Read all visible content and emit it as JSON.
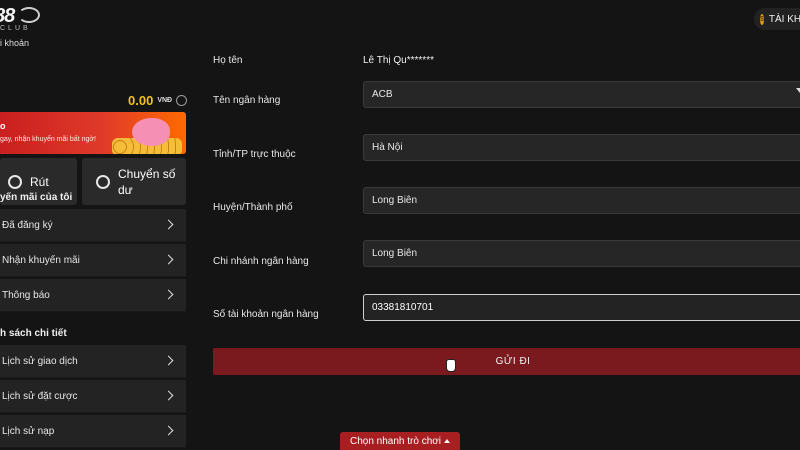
{
  "header": {
    "logo_text": "88",
    "logo_sub": "CLUB",
    "account_label": "TÀI KHOẢN",
    "coin_symbol": "$"
  },
  "sidebar": {
    "top_label": "i khoản",
    "balance": {
      "amount": "0.00",
      "currency": "VNĐ"
    },
    "promo": {
      "title": "o",
      "text": "gay, nhận khuyến mãi bất ngờ!"
    },
    "tiles": [
      {
        "label": "Rút"
      },
      {
        "label": "Chuyển số dư"
      }
    ],
    "promo_section_title": "yến mãi của tôi",
    "promo_items": [
      {
        "label": "Đã đăng ký"
      },
      {
        "label": "Nhận khuyến mãi"
      },
      {
        "label": "Thông báo"
      }
    ],
    "detail_section_title": "h sách chi tiết",
    "detail_items": [
      {
        "label": "Lịch sử giao dịch"
      },
      {
        "label": "Lịch sử đặt cược"
      },
      {
        "label": "Lịch sử nạp"
      }
    ]
  },
  "form": {
    "full_name": {
      "label": "Họ tên",
      "value": "Lê Thị Qu*******"
    },
    "bank_name": {
      "label": "Tên ngân hàng",
      "value": "ACB"
    },
    "province": {
      "label": "Tỉnh/TP trực thuộc",
      "value": "Hà Nội"
    },
    "district": {
      "label": "Huyện/Thành phố",
      "value": "Long Biên"
    },
    "branch": {
      "label": "Chi nhánh ngân hàng",
      "value": "Long Biên"
    },
    "account_number": {
      "label": "Số tài khoản ngân hàng",
      "value": "03381810701"
    },
    "submit_label": "GỬI ĐI"
  },
  "footer": {
    "quick_game_label": "Chọn nhanh trò chơi"
  },
  "colors": {
    "accent_gold": "#f2c21b",
    "submit_red": "#7a1a1f",
    "quick_game_red": "#a81f22",
    "background": "#141414"
  }
}
